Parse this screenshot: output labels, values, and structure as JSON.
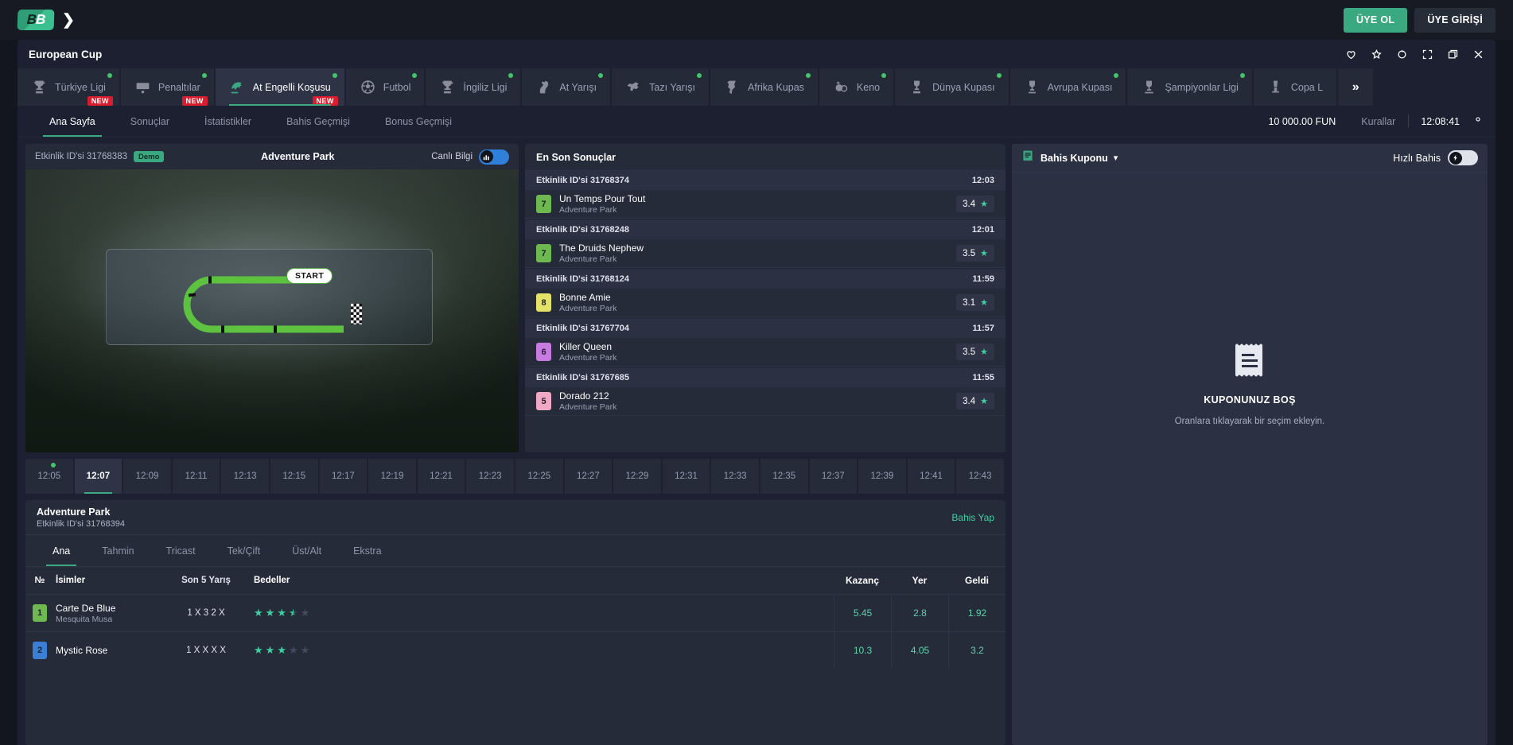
{
  "topbar": {
    "logo_left": "B",
    "logo_right": "B",
    "chevron": "❯",
    "signup_label": "ÜYE OL",
    "login_label": "ÜYE GİRİŞİ"
  },
  "window": {
    "title": "European Cup",
    "icons": [
      "heart-icon",
      "star-icon",
      "refresh-icon",
      "fullscreen-icon",
      "window-icon",
      "close-icon"
    ]
  },
  "sport_tabs": [
    {
      "label": "Türkiye Ligi",
      "icon": "trophy-icon",
      "dot": true,
      "new": true,
      "active": false
    },
    {
      "label": "Penaltılar",
      "icon": "goal-icon",
      "dot": true,
      "new": true,
      "active": false
    },
    {
      "label": "At Engelli Koşusu",
      "icon": "steeplechase-icon",
      "dot": true,
      "new": true,
      "active": true
    },
    {
      "label": "Futbol",
      "icon": "football-icon",
      "dot": true,
      "new": false,
      "active": false
    },
    {
      "label": "İngiliz Ligi",
      "icon": "trophy-icon",
      "dot": true,
      "new": false,
      "active": false
    },
    {
      "label": "At Yarışı",
      "icon": "horse-icon",
      "dot": true,
      "new": false,
      "active": false
    },
    {
      "label": "Tazı Yarışı",
      "icon": "greyhound-icon",
      "dot": true,
      "new": false,
      "active": false
    },
    {
      "label": "Afrika Kupas",
      "icon": "africa-icon",
      "dot": true,
      "new": false,
      "active": false
    },
    {
      "label": "Keno",
      "icon": "keno-icon",
      "dot": true,
      "new": false,
      "active": false
    },
    {
      "label": "Dünya Kupası",
      "icon": "worldcup-icon",
      "dot": true,
      "new": false,
      "active": false
    },
    {
      "label": "Avrupa Kupası",
      "icon": "cup-icon",
      "dot": true,
      "new": false,
      "active": false
    },
    {
      "label": "Şampiyonlar Ligi",
      "icon": "ucl-icon",
      "dot": true,
      "new": false,
      "active": false
    },
    {
      "label": "Copa L",
      "icon": "copa-icon",
      "dot": false,
      "new": false,
      "active": false
    }
  ],
  "sport_tabs_more": "»",
  "subnav": {
    "tabs": [
      {
        "label": "Ana Sayfa",
        "active": true
      },
      {
        "label": "Sonuçlar",
        "active": false
      },
      {
        "label": "İstatistikler",
        "active": false
      },
      {
        "label": "Bahis Geçmişi",
        "active": false
      },
      {
        "label": "Bonus Geçmişi",
        "active": false
      }
    ],
    "balance": "10 000.00 FUN",
    "rules": "Kurallar",
    "clock": "12:08:41",
    "settings_icon": "gear-icon"
  },
  "video_panel": {
    "event_id_label": "Etkinlik ID'si 31768383",
    "demo_badge": "Demo",
    "event_name": "Adventure Park",
    "live_label": "Canlı Bilgi",
    "live_toggle_on": true,
    "start_label": "START"
  },
  "results_panel": {
    "title": "En Son Sonuçlar",
    "groups": [
      {
        "event_id": "Etkinlik ID'si 31768374",
        "time": "12:03",
        "runner_number": "7",
        "runner_color": "#6db94f",
        "runner_name": "Un Temps Pour Tout",
        "track": "Adventure Park",
        "odds": "3.4"
      },
      {
        "event_id": "Etkinlik ID'si 31768248",
        "time": "12:01",
        "runner_number": "7",
        "runner_color": "#6db94f",
        "runner_name": "The Druids Nephew",
        "track": "Adventure Park",
        "odds": "3.5"
      },
      {
        "event_id": "Etkinlik ID'si 31768124",
        "time": "11:59",
        "runner_number": "8",
        "runner_color": "#e5e367",
        "runner_name": "Bonne Amie",
        "track": "Adventure Park",
        "odds": "3.1"
      },
      {
        "event_id": "Etkinlik ID'si 31767704",
        "time": "11:57",
        "runner_number": "6",
        "runner_color": "#c77be0",
        "runner_name": "Killer Queen",
        "track": "Adventure Park",
        "odds": "3.5"
      },
      {
        "event_id": "Etkinlik ID'si 31767685",
        "time": "11:55",
        "runner_number": "5",
        "runner_color": "#f0a8c4",
        "runner_name": "Dorado 212",
        "track": "Adventure Park",
        "odds": "3.4"
      }
    ]
  },
  "timeline": {
    "times": [
      "12:05",
      "12:07",
      "12:09",
      "12:11",
      "12:13",
      "12:15",
      "12:17",
      "12:19",
      "12:21",
      "12:23",
      "12:25",
      "12:27",
      "12:29",
      "12:31",
      "12:33",
      "12:35",
      "12:37",
      "12:39",
      "12:41",
      "12:43"
    ],
    "active_index": 1,
    "dot_index": 0
  },
  "race_card": {
    "title": "Adventure Park",
    "event_id": "Etkinlik ID'si 31768394",
    "bet_link": "Bahis Yap",
    "tabs": [
      {
        "label": "Ana",
        "active": true
      },
      {
        "label": "Tahmin",
        "active": false
      },
      {
        "label": "Tricast",
        "active": false
      },
      {
        "label": "Tek/Çift",
        "active": false
      },
      {
        "label": "Üst/Alt",
        "active": false
      },
      {
        "label": "Ekstra",
        "active": false
      }
    ],
    "columns": {
      "num": "№",
      "names": "İsimler",
      "last5": "Son 5 Yarış",
      "ratings": "Bedeller",
      "win": "Kazanç",
      "place": "Yer",
      "came": "Geldi"
    },
    "rows": [
      {
        "num": "1",
        "num_color": "#6db94f",
        "name": "Carte De Blue",
        "jockey": "Mesquita Musa",
        "last5": "1 X 3 2 X",
        "stars": 3.5,
        "win": "5.45",
        "place": "2.8",
        "came": "1.92"
      },
      {
        "num": "2",
        "num_color": "#3b7fd4",
        "name": "Mystic Rose",
        "jockey": "",
        "last5": "1 X X X X",
        "stars": 3,
        "win": "10.3",
        "place": "4.05",
        "came": "3.2"
      }
    ]
  },
  "betslip": {
    "icon": "receipt-icon",
    "title": "Bahis Kuponu",
    "chevron": "▾",
    "quick_bet_label": "Hızlı Bahis",
    "quick_bet_on": false,
    "empty_title": "KUPONUNUZ BOŞ",
    "empty_sub": "Oranlara tıklayarak bir seçim ekleyin."
  },
  "colors": {
    "accent": "#3aa981",
    "accent_light": "#3ecfa0",
    "panel": "#262b3a",
    "panel_dark": "#1c2030",
    "bg": "#14161f",
    "badge_new": "#d81e2e",
    "dot_green": "#44c46a"
  }
}
